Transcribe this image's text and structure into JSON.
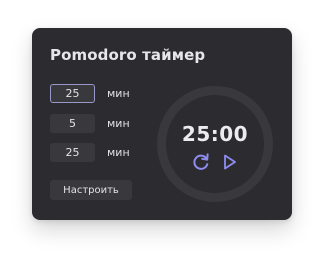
{
  "widget": {
    "title": "Pomodoro таймер",
    "settings": [
      {
        "value": "25",
        "unit": "мин"
      },
      {
        "value": "5",
        "unit": "мин"
      },
      {
        "value": "25",
        "unit": "мин"
      }
    ],
    "configure_label": "Настроить",
    "time": "25:00",
    "icons": {
      "reset": "refresh-icon",
      "play": "play-icon"
    },
    "colors": {
      "card": "#2c2c30",
      "ring": "#38383d",
      "accent": "#9a97c9",
      "icon": "#8f8cf0",
      "text": "#e7e7ea"
    }
  }
}
